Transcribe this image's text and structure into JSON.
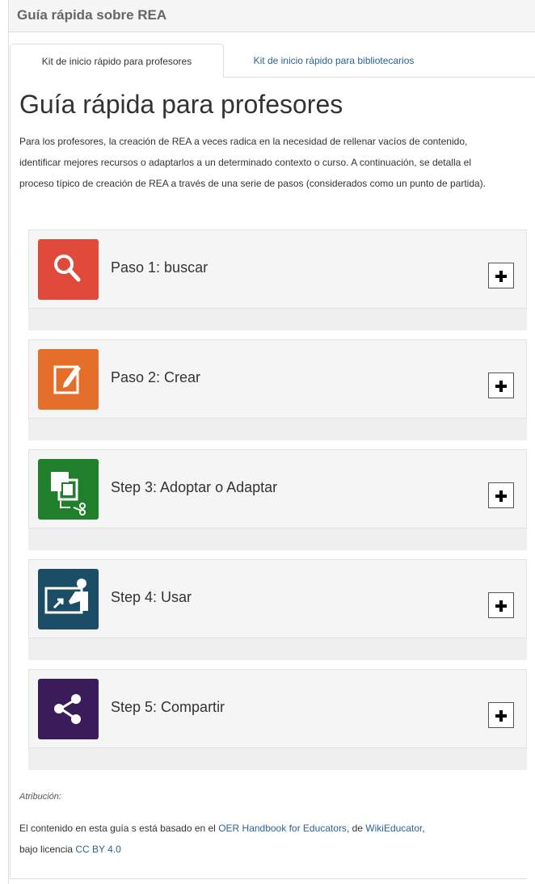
{
  "panel": {
    "title": "Guía rápida sobre REA"
  },
  "tabs": [
    {
      "label": "Kit de inicio rápido para profesores",
      "active": true
    },
    {
      "label": "Kit de inicio rápido para bibliotecarios",
      "active": false
    }
  ],
  "main": {
    "title": "Guía rápida para profesores",
    "intro": "Para los profesores, la creación de REA a veces radica en la necesidad de rellenar vacíos de contenido, identificar mejores recursos o adaptarlos a un determinado contexto o curso. A continuación, se detalla el proceso típico de creación de REA a través de una serie de pasos (considerados como un punto de partida)."
  },
  "steps": [
    {
      "label": "Paso 1: buscar",
      "icon": "search-icon",
      "color": "#e04a3a"
    },
    {
      "label": "Paso 2: Crear",
      "icon": "edit-icon",
      "color": "#e46f2a"
    },
    {
      "label": "Step 3: Adoptar o Adaptar",
      "icon": "adapt-icon",
      "color": "#1f7f2a"
    },
    {
      "label": "Step 4: Usar",
      "icon": "presentation-icon",
      "color": "#1b4e66"
    },
    {
      "label": "Step 5: Compartir",
      "icon": "share-icon",
      "color": "#3b1c5a"
    }
  ],
  "attribution": {
    "label": "Atribución:",
    "text_before": "El contenido en esta guía s está basado en el ",
    "link1": "OER Handbook for Educators",
    "text_mid": ", de ",
    "link2": "WikiEducator",
    "text_mid2": ",",
    "text_line2": "bajo licencia ",
    "link3": "CC BY 4.0"
  }
}
